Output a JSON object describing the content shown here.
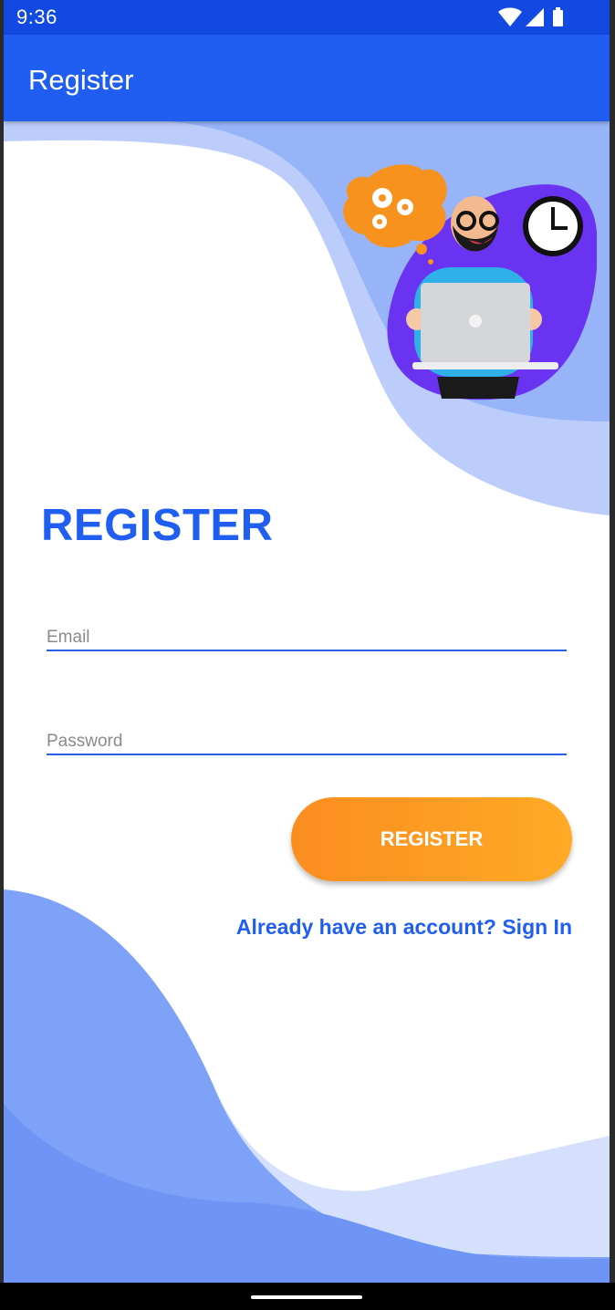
{
  "status_bar": {
    "time": "9:36",
    "icons": [
      "wifi-icon",
      "cellular-signal-icon",
      "battery-icon"
    ]
  },
  "app_bar": {
    "title": "Register"
  },
  "form": {
    "heading": "REGISTER",
    "email_placeholder": "Email",
    "email_value": "",
    "password_placeholder": "Password",
    "password_value": "",
    "submit_label": "REGISTER",
    "signin_link": "Already have an account? Sign In"
  },
  "colors": {
    "status_bar": "#1249e3",
    "app_bar": "#1f5ef0",
    "accent_blue": "#1f5ef0",
    "button_gradient_start": "#fb8d20",
    "button_gradient_end": "#ffaa26",
    "illustration_blob": "#6a33f2"
  }
}
